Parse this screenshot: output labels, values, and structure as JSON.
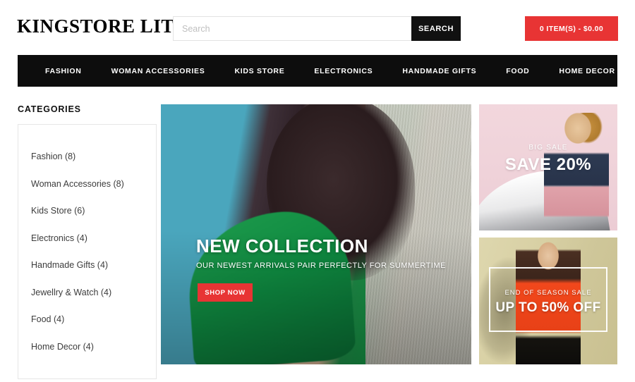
{
  "header": {
    "logo": "KINGSTORE LITE",
    "search": {
      "placeholder": "Search",
      "value": "",
      "button_label": "SEARCH"
    },
    "cart": {
      "label": "0 ITEM(S) - $0.00",
      "accent_color": "#e83434"
    }
  },
  "nav": {
    "background_color": "#0d0d0d",
    "items": [
      {
        "label": "FASHION"
      },
      {
        "label": "WOMAN ACCESSORIES"
      },
      {
        "label": "KIDS STORE"
      },
      {
        "label": "ELECTRONICS"
      },
      {
        "label": "HANDMADE GIFTS"
      },
      {
        "label": "FOOD"
      },
      {
        "label": "HOME DECOR"
      }
    ]
  },
  "sidebar": {
    "title": "CATEGORIES",
    "items": [
      {
        "label": "Fashion (8)"
      },
      {
        "label": "Woman Accessories (8)"
      },
      {
        "label": "Kids Store (6)"
      },
      {
        "label": "Electronics (4)"
      },
      {
        "label": "Handmade Gifts (4)"
      },
      {
        "label": "Jewellry & Watch (4)"
      },
      {
        "label": "Food (4)"
      },
      {
        "label": "Home Decor (4)"
      }
    ]
  },
  "hero": {
    "title": "NEW COLLECTION",
    "subtitle": "OUR NEWEST ARRIVALS PAIR PERFECTLY FOR SUMMERTIME",
    "cta_label": "SHOP NOW",
    "cta_color": "#e83434"
  },
  "promos": {
    "top": {
      "eyebrow": "BIG SALE",
      "headline": "SAVE 20%",
      "background_color": "#efd2d9"
    },
    "bottom": {
      "eyebrow": "END OF SEASON SALE",
      "headline": "UP TO 50% OFF",
      "background_color": "#d8d0a4"
    }
  }
}
